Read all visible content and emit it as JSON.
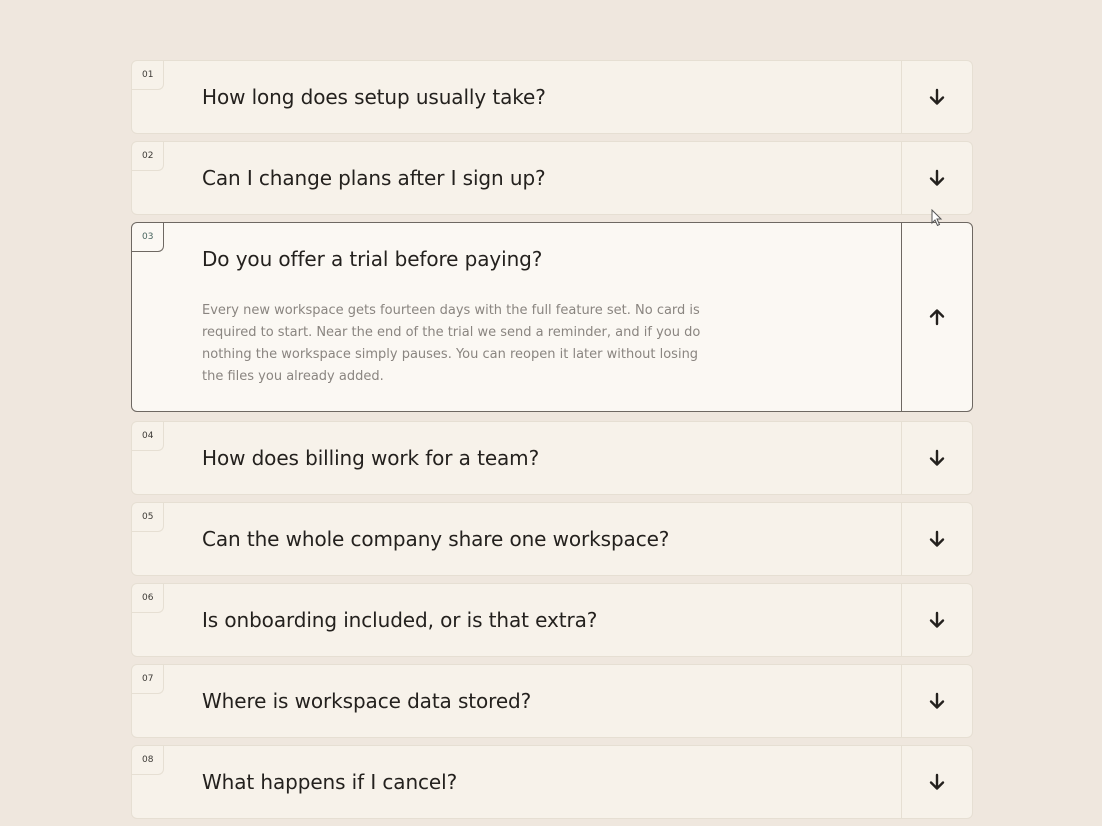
{
  "faq": {
    "items": [
      {
        "number": "01",
        "question": "How long does setup usually take?",
        "expanded": false,
        "toggle_icon": "arrow-down-icon"
      },
      {
        "number": "02",
        "question": "Can I change plans after I sign up?",
        "expanded": false,
        "toggle_icon": "arrow-down-icon"
      },
      {
        "number": "03",
        "question": "Do you offer a trial before paying?",
        "expanded": true,
        "toggle_icon": "arrow-up-icon",
        "answer": "Every new workspace gets fourteen days with the full feature set. No card is required to start. Near the end of the trial we send a reminder, and if you do nothing the workspace simply pauses. You can reopen it later without losing the files you already added."
      },
      {
        "number": "04",
        "question": "How does billing work for a team?",
        "expanded": false,
        "toggle_icon": "arrow-down-icon"
      },
      {
        "number": "05",
        "question": "Can the whole company share one workspace?",
        "expanded": false,
        "toggle_icon": "arrow-down-icon"
      },
      {
        "number": "06",
        "question": "Is onboarding included, or is that extra?",
        "expanded": false,
        "toggle_icon": "arrow-down-icon"
      },
      {
        "number": "07",
        "question": "Where is workspace data stored?",
        "expanded": false,
        "toggle_icon": "arrow-down-icon"
      },
      {
        "number": "08",
        "question": "What happens if I cancel?",
        "expanded": false,
        "toggle_icon": "arrow-down-icon"
      }
    ]
  },
  "colors": {
    "page_background": "#efe7de",
    "card_background": "#f7f2ea",
    "open_card_border": "#6e6862",
    "question_text": "#24211e",
    "answer_text": "#8a8580"
  }
}
